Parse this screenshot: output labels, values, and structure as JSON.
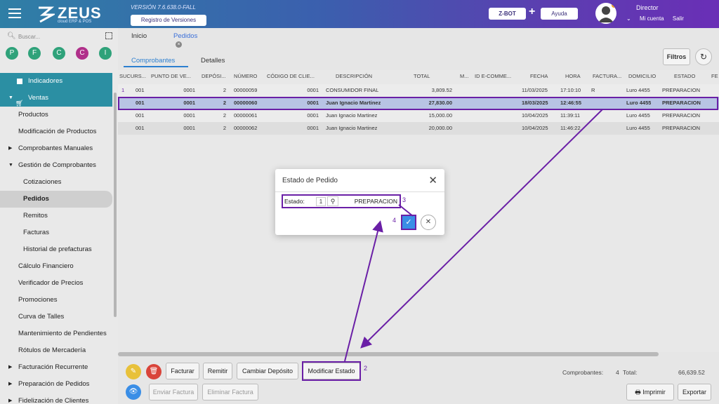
{
  "header": {
    "logo_text": "ZEUS",
    "logo_sub": "cloud ERP & POS",
    "version": "VERSIÓN 7.6.638.0-FALL",
    "registro_btn": "Registro de Versiones",
    "zbot_btn": "Z-BOT",
    "plus": "+",
    "ayuda_btn": "Ayuda",
    "user_name": "Director",
    "mi_cuenta": "Mi cuenta",
    "salir": "Salir"
  },
  "sidebar": {
    "search_placeholder": "Buscar...",
    "shortcuts": [
      {
        "letter": "P",
        "color": "#2fa27a"
      },
      {
        "letter": "F",
        "color": "#2fa27a"
      },
      {
        "letter": "C",
        "color": "#2fa27a"
      },
      {
        "letter": "C",
        "color": "#b0308a"
      },
      {
        "letter": "I",
        "color": "#2fa27a"
      }
    ],
    "items": [
      {
        "label": "Indicadores"
      },
      {
        "label": "Ventas"
      },
      {
        "label": "Productos"
      },
      {
        "label": "Modificación de Productos"
      },
      {
        "label": "Comprobantes Manuales"
      },
      {
        "label": "Gestión de Comprobantes"
      },
      {
        "label": "Cotizaciones"
      },
      {
        "label": "Pedidos"
      },
      {
        "label": "Remitos"
      },
      {
        "label": "Facturas"
      },
      {
        "label": "Historial de prefacturas"
      },
      {
        "label": "Cálculo Financiero"
      },
      {
        "label": "Verificador de Precios"
      },
      {
        "label": "Promociones"
      },
      {
        "label": "Curva de Talles"
      },
      {
        "label": "Mantenimiento de Pendientes"
      },
      {
        "label": "Rótulos de Mercadería"
      },
      {
        "label": "Facturación Recurrente"
      },
      {
        "label": "Preparación de Pedidos"
      },
      {
        "label": "Fidelización de Clientes"
      }
    ]
  },
  "main": {
    "tabs": [
      {
        "label": "Inicio"
      },
      {
        "label": "Pedidos"
      }
    ],
    "subtabs": [
      {
        "label": "Comprobantes"
      },
      {
        "label": "Detalles"
      }
    ],
    "filtros_btn": "Filtros",
    "columns": [
      "SUCURS...",
      "PUNTO DE VE...",
      "DEPÓSI...",
      "NÚMERO",
      "CÓDIGO DE CLIE...",
      "DESCRIPCIÓN",
      "TOTAL",
      "M...",
      "ID E-COMME...",
      "FECHA",
      "HORA",
      "FACTURA...",
      "DOMICILIO",
      "ESTADO",
      "FE"
    ],
    "rows": [
      {
        "sel": "1",
        "suc": "001",
        "pv": "0001",
        "dep": "2",
        "num": "00000059",
        "cod": "0001",
        "desc": "CONSUMIDOR FINAL",
        "total": "3,809.52",
        "fecha": "11/03/2025",
        "hora": "17:10:10",
        "fact": "R",
        "dom": "Luro 4455",
        "estado": "PREPARACION"
      },
      {
        "sel": "",
        "suc": "001",
        "pv": "0001",
        "dep": "2",
        "num": "00000060",
        "cod": "0001",
        "desc": "Juan Ignacio Martinez",
        "total": "27,830.00",
        "fecha": "18/03/2025",
        "hora": "12:46:55",
        "fact": "",
        "dom": "Luro 4455",
        "estado": "PREPARACION"
      },
      {
        "sel": "",
        "suc": "001",
        "pv": "0001",
        "dep": "2",
        "num": "00000061",
        "cod": "0001",
        "desc": "Juan Ignacio Martinez",
        "total": "15,000.00",
        "fecha": "10/04/2025",
        "hora": "11:39:11",
        "fact": "",
        "dom": "Luro 4455",
        "estado": "PREPARACION"
      },
      {
        "sel": "",
        "suc": "001",
        "pv": "0001",
        "dep": "2",
        "num": "00000062",
        "cod": "0001",
        "desc": "Juan Ignacio Martinez",
        "total": "20,000.00",
        "fecha": "10/04/2025",
        "hora": "11:46:22",
        "fact": "",
        "dom": "Luro 4455",
        "estado": "PREPARACION"
      }
    ],
    "toolbar": {
      "facturar": "Facturar",
      "remitir": "Remitir",
      "cambiar_deposito": "Cambiar Depósito",
      "modificar_estado": "Modificar Estado",
      "enviar_factura": "Enviar Factura",
      "eliminar_factura": "Eliminar Factura",
      "imprimir": "Imprimir",
      "exportar": "Exportar"
    },
    "totals": {
      "comprobantes_label": "Comprobantes:",
      "comprobantes_value": "4",
      "total_label": "Total:",
      "total_value": "66,639.52"
    }
  },
  "modal": {
    "title": "Estado de Pedido",
    "estado_label": "Estado:",
    "estado_code": "1",
    "estado_value": "PREPARACION"
  },
  "annotations": {
    "a2": "2",
    "a3": "3",
    "a4": "4"
  },
  "colors": {
    "accent": "#3b6fd8",
    "teal": "#2b8fa3",
    "annotation": "#6a1fa6"
  }
}
